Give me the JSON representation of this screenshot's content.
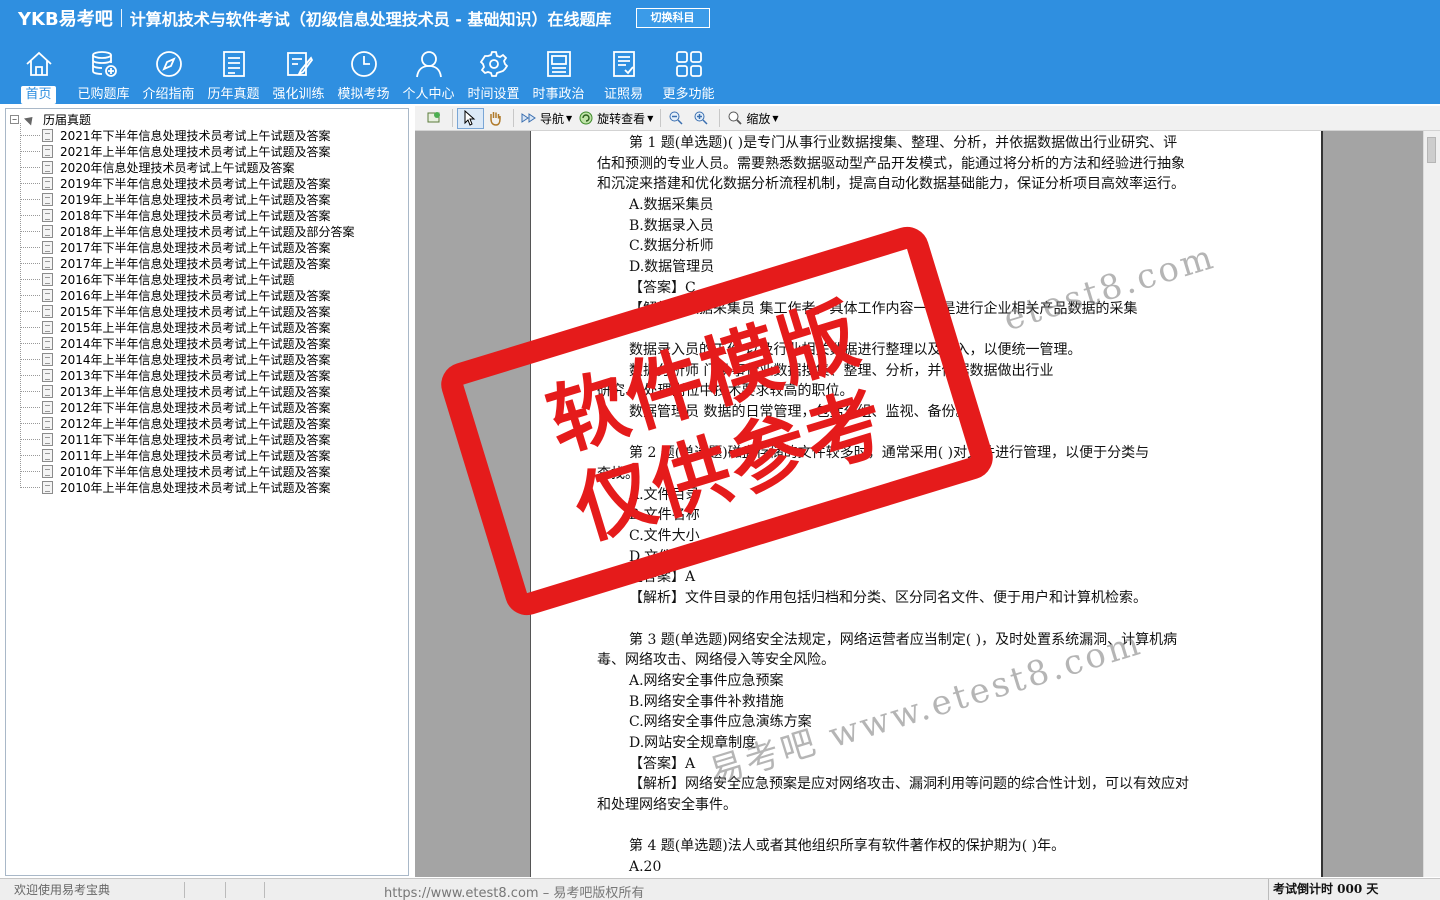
{
  "header": {
    "brand": "YKB易考吧",
    "title": "计算机技术与软件考试（初级信息处理技术员 - 基础知识）在线题库",
    "switch_label": "切换科目"
  },
  "nav": [
    {
      "label": "首页",
      "icon": "home-icon"
    },
    {
      "label": "已购题库",
      "icon": "database-icon"
    },
    {
      "label": "介绍指南",
      "icon": "compass-icon"
    },
    {
      "label": "历年真题",
      "icon": "list-icon"
    },
    {
      "label": "强化训练",
      "icon": "edit-icon"
    },
    {
      "label": "模拟考场",
      "icon": "clock-icon"
    },
    {
      "label": "个人中心",
      "icon": "user-icon"
    },
    {
      "label": "时间设置",
      "icon": "gear-icon"
    },
    {
      "label": "时事政治",
      "icon": "news-icon"
    },
    {
      "label": "证照易",
      "icon": "certificate-icon"
    },
    {
      "label": "更多功能",
      "icon": "grid-icon"
    }
  ],
  "tree": {
    "root_label": "历届真题",
    "expander": "−",
    "items": [
      "2021年下半年信息处理技术员考试上午试题及答案",
      "2021年上半年信息处理技术员考试上午试题及答案",
      "2020年信息处理技术员考试上午试题及答案",
      "2019年下半年信息处理技术员考试上午试题及答案",
      "2019年上半年信息处理技术员考试上午试题及答案",
      "2018年下半年信息处理技术员考试上午试题及答案",
      "2018年上半年信息处理技术员考试上午试题及部分答案",
      "2017年下半年信息处理技术员考试上午试题及答案",
      "2017年上半年信息处理技术员考试上午试题及答案",
      "2016年下半年信息处理技术员考试上午试题",
      "2016年上半年信息处理技术员考试上午试题及答案",
      "2015年下半年信息处理技术员考试上午试题及答案",
      "2015年上半年信息处理技术员考试上午试题及答案",
      "2014年下半年信息处理技术员考试上午试题及答案",
      "2014年上半年信息处理技术员考试上午试题及答案",
      "2013年下半年信息处理技术员考试上午试题及答案",
      "2013年上半年信息处理技术员考试上午试题及答案",
      "2012年下半年信息处理技术员考试上午试题及答案",
      "2012年上半年信息处理技术员考试上午试题及答案",
      "2011年下半年信息处理技术员考试上午试题及答案",
      "2011年上半年信息处理技术员考试上午试题及答案",
      "2010年下半年信息处理技术员考试上午试题及答案",
      "2010年上半年信息处理技术员考试上午试题及答案"
    ]
  },
  "toolbar": {
    "nav_label": "导航",
    "rotate_label": "旋转查看",
    "zoom_label": "缩放"
  },
  "document": {
    "lines": [
      {
        "t": "第 1 题(单选题)(  )是专门从事行业数据搜集、整理、分析，并依据数据做出行业研究、评",
        "indent": true
      },
      {
        "t": "估和预测的专业人员。需要熟悉数据驱动型产品开发模式，能通过将分析的方法和经验进行抽象",
        "indent": false
      },
      {
        "t": "和沉淀来搭建和优化数据分析流程机制，提高自动化数据基础能力，保证分析项目高效率运行。",
        "indent": false
      },
      {
        "t": "A.数据采集员",
        "indent": true
      },
      {
        "t": "B.数据录入员",
        "indent": true
      },
      {
        "t": "C.数据分析师",
        "indent": true
      },
      {
        "t": "D.数据管理员",
        "indent": true
      },
      {
        "t": "【答案】C",
        "indent": true
      },
      {
        "t": "【解析】数据采集员        集工作者，具体工作内容一般是进行企业相关产品数据的采集",
        "indent": true
      },
      {
        "t": "工作。",
        "indent": false
      },
      {
        "t": "数据录入员的工作        以及行业相关数据进行整理以及录入，以便统一管理。",
        "indent": true
      },
      {
        "t": "数据分析师        门从事行业数据搜集、整理、分析，并依据数据做出行业",
        "indent": true
      },
      {
        "t": "研究、        处理岗位中技术要求较高的职位。",
        "indent": false
      },
      {
        "t": "数据管理员        数据的日常管理，包括分组、监视、备份。",
        "indent": true
      },
      {
        "t": "",
        "indent": false
      },
      {
        "t": "第 2 题(单选题)磁盘存储的文件较多时，通常采用(  )对文件进行管理，以便于分类与",
        "indent": true
      },
      {
        "t": "查找。",
        "indent": false
      },
      {
        "t": "A.文件目录",
        "indent": true
      },
      {
        "t": "B.文件名称",
        "indent": true
      },
      {
        "t": "C.文件大小",
        "indent": true
      },
      {
        "t": "D.文件压缩",
        "indent": true
      },
      {
        "t": "【答案】A",
        "indent": true
      },
      {
        "t": "【解析】文件目录的作用包括归档和分类、区分同名文件、便于用户和计算机检索。",
        "indent": true
      },
      {
        "t": "",
        "indent": false
      },
      {
        "t": "第 3 题(单选题)网络安全法规定，网络运营者应当制定(  )，及时处置系统漏洞、计算机病",
        "indent": true
      },
      {
        "t": "毒、网络攻击、网络侵入等安全风险。",
        "indent": false
      },
      {
        "t": "A.网络安全事件应急预案",
        "indent": true
      },
      {
        "t": "B.网络安全事件补救措施",
        "indent": true
      },
      {
        "t": "C.网络安全事件应急演练方案",
        "indent": true
      },
      {
        "t": "D.网站安全规章制度",
        "indent": true
      },
      {
        "t": "【答案】A",
        "indent": true
      },
      {
        "t": "【解析】网络安全应急预案是应对网络攻击、漏洞利用等问题的综合性计划，可以有效应对",
        "indent": true
      },
      {
        "t": "和处理网络安全事件。",
        "indent": false
      },
      {
        "t": "",
        "indent": false
      },
      {
        "t": "第 4 题(单选题)法人或者其他组织所享有软件著作权的保护期为(  )年。",
        "indent": true
      },
      {
        "t": "A.20",
        "indent": true
      }
    ]
  },
  "watermark": {
    "stamp_line1": "软件模版",
    "stamp_line2": "仅供参考",
    "site1": "etest8.com",
    "site2": "易考吧 www.etest8.com",
    "color": "#e51b1b"
  },
  "status": {
    "welcome": "欢迎使用易考宝典",
    "copyright": "https://www.etest8.com – 易考吧版权所有",
    "countdown": "考试倒计时 000 天"
  },
  "colors": {
    "header_bg": "#2f8fe0",
    "viewer_bg": "#a4a4a4"
  }
}
